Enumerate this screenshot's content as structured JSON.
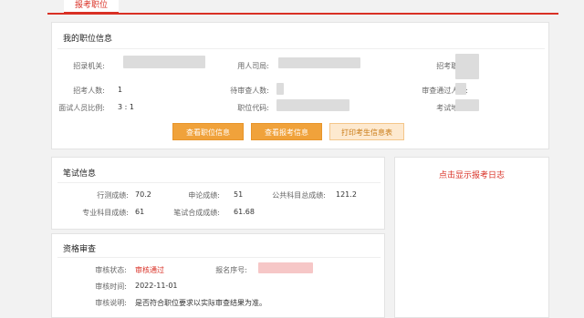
{
  "tabs": {
    "active": "报考职位"
  },
  "position_info": {
    "title": "我的职位信息",
    "fields": {
      "recruit_org_label": "招录机关:",
      "employer_label": "用人司局:",
      "position_label": "招考职位:",
      "headcount_label": "招考人数:",
      "headcount_value": "1",
      "pending_label": "待审查人数:",
      "passed_label": "审查通过人数:",
      "interview_ratio_label": "面试人员比例:",
      "interview_ratio_value": "3 : 1",
      "position_code_label": "职位代码:",
      "exam_site_label": "考试地点:"
    },
    "buttons": {
      "view_position": "查看职位信息",
      "view_application": "查看报考信息",
      "print_card": "打印考生信息表"
    }
  },
  "written_exam": {
    "title": "笔试信息",
    "xingce_label": "行测成绩:",
    "xingce_value": "70.2",
    "shenlun_label": "申论成绩:",
    "shenlun_value": "51",
    "public_total_label": "公共科目总成绩:",
    "public_total_value": "121.2",
    "major_label": "专业科目成绩:",
    "major_value": "61",
    "combined_label": "笔试合成成绩:",
    "combined_value": "61.68"
  },
  "qualification": {
    "title": "资格审查",
    "status_label": "审核状态:",
    "status_value": "审核通过",
    "regno_label": "报名序号:",
    "time_label": "审核时间:",
    "time_value": "2022-11-01",
    "note_label": "审核说明:",
    "note_value": "是否符合职位要求以实际审查结果为准。"
  },
  "log": {
    "link": "点击显示报考日志"
  },
  "colors": {
    "accent": "#d93025",
    "button": "#f0a23b"
  }
}
